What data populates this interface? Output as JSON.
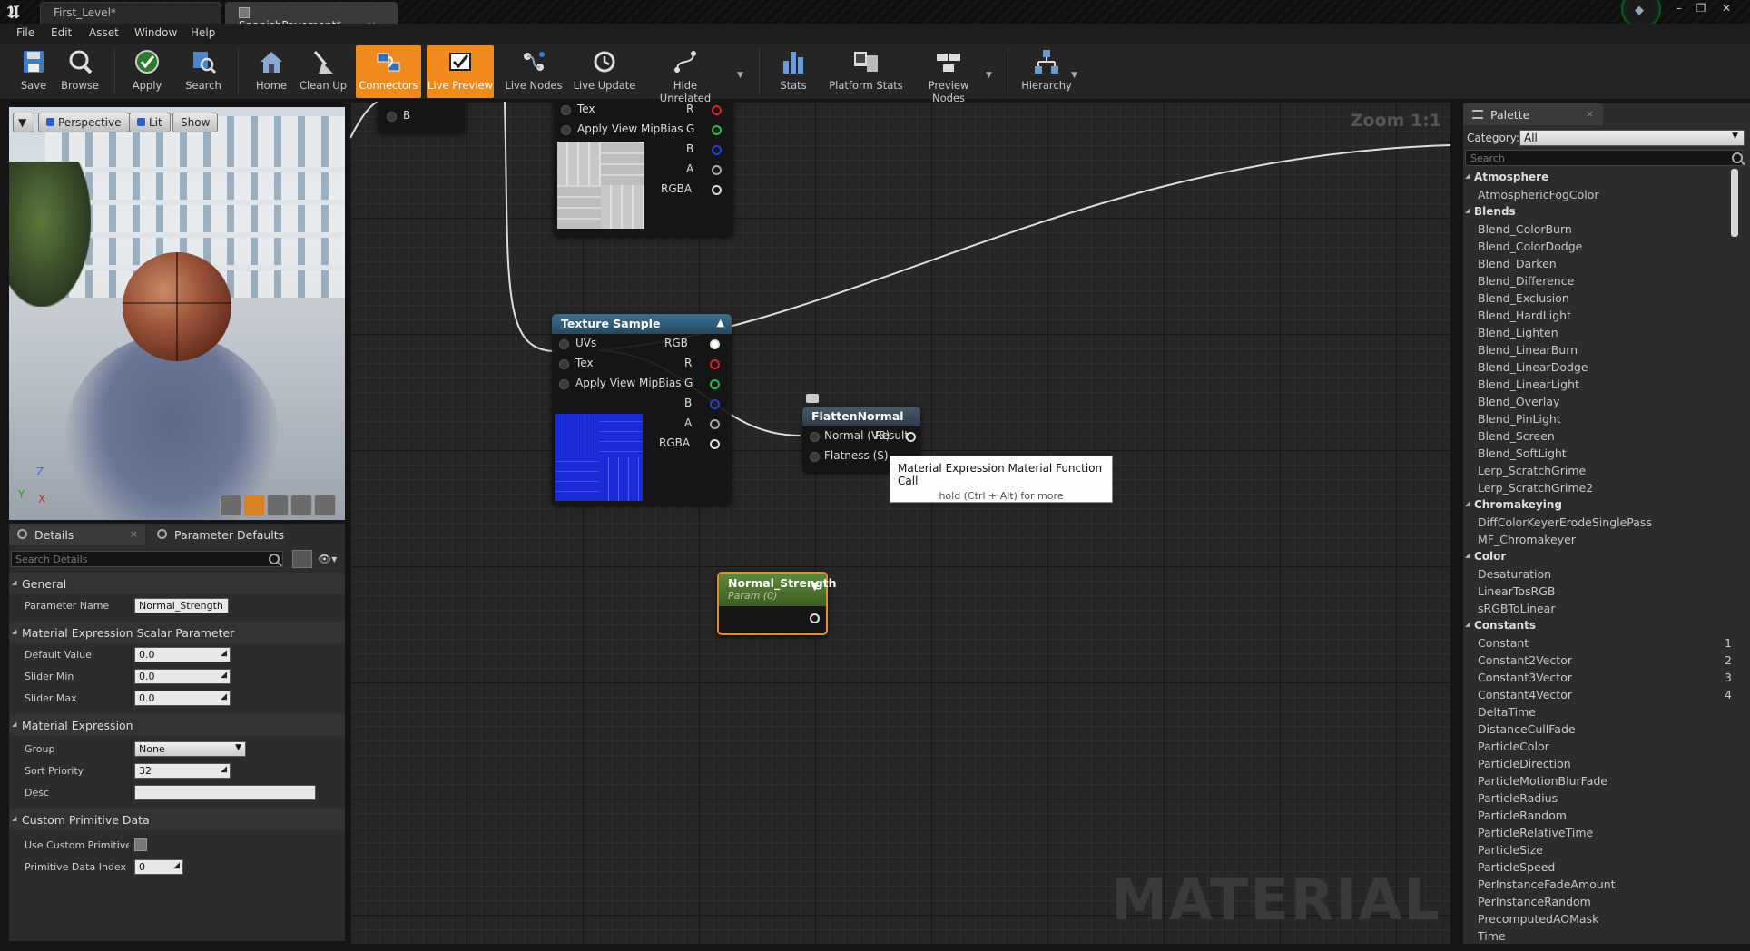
{
  "titlebar": {
    "tabs": [
      {
        "label": "First_Level*"
      },
      {
        "label": "SpanishPavement*",
        "close": "×"
      }
    ],
    "window_buttons": [
      "–",
      "❐",
      "✕"
    ]
  },
  "menu": [
    "File",
    "Edit",
    "Asset",
    "Window",
    "Help"
  ],
  "toolbar": {
    "buttons": [
      {
        "label": "Save",
        "icon": "save-icon"
      },
      {
        "label": "Browse",
        "icon": "browse-icon"
      },
      {
        "label": "Apply",
        "icon": "apply-icon"
      },
      {
        "label": "Search",
        "icon": "search-icon"
      },
      {
        "label": "Home",
        "icon": "home-icon"
      },
      {
        "label": "Clean Up",
        "icon": "clean-up-icon"
      },
      {
        "label": "Connectors",
        "icon": "connectors-icon",
        "active": true
      },
      {
        "label": "Live Preview",
        "icon": "live-preview-icon",
        "active": true
      },
      {
        "label": "Live Nodes",
        "icon": "live-nodes-icon"
      },
      {
        "label": "Live Update",
        "icon": "live-update-icon"
      },
      {
        "label": "Hide Unrelated",
        "icon": "hide-unrelated-icon"
      },
      {
        "label": "Stats",
        "icon": "stats-icon"
      },
      {
        "label": "Platform Stats",
        "icon": "platform-stats-icon"
      },
      {
        "label": "Preview Nodes",
        "icon": "preview-nodes-icon"
      },
      {
        "label": "Hierarchy",
        "icon": "hierarchy-icon"
      }
    ],
    "accent": "#f08a1d"
  },
  "viewport": {
    "perspective": "Perspective",
    "lit": "Lit",
    "show": "Show",
    "axis": {
      "z": "Z",
      "x": "X",
      "y": "Y"
    }
  },
  "details": {
    "tabs": [
      "Details",
      "Parameter Defaults"
    ],
    "search_placeholder": "Search Details",
    "sections": {
      "general": "General",
      "scalar": "Material Expression Scalar Parameter",
      "expression": "Material Expression",
      "custom": "Custom Primitive Data"
    },
    "props": {
      "parameter_name": {
        "label": "Parameter Name",
        "value": "Normal_Strength"
      },
      "default_value": {
        "label": "Default Value",
        "value": "0.0"
      },
      "slider_min": {
        "label": "Slider Min",
        "value": "0.0"
      },
      "slider_max": {
        "label": "Slider Max",
        "value": "0.0"
      },
      "group": {
        "label": "Group",
        "value": "None"
      },
      "sort_priority": {
        "label": "Sort Priority",
        "value": "32"
      },
      "desc": {
        "label": "Desc",
        "value": ""
      },
      "use_custom": {
        "label": "Use Custom Primitive Data",
        "checked": false
      },
      "prim_index": {
        "label": "Primitive Data Index",
        "value": "0"
      }
    }
  },
  "graph": {
    "zoom": "Zoom 1:1",
    "watermark": "MATERIAL",
    "partial_node": {
      "pin": "B"
    },
    "tex_top": {
      "pins_in": [
        "Tex",
        "Apply View MipBias"
      ],
      "pins_out": [
        "R",
        "G",
        "B",
        "A",
        "RGBA"
      ]
    },
    "tex_main": {
      "title": "Texture Sample",
      "pins_in": [
        "UVs",
        "Tex",
        "Apply View MipBias"
      ],
      "pins_out": [
        "RGB",
        "R",
        "G",
        "B",
        "A",
        "RGBA"
      ]
    },
    "flatten": {
      "title": "FlattenNormal",
      "in1": "Normal (V3)",
      "out1": "Result",
      "in2": "Flatness (S)"
    },
    "tooltip": {
      "title": "Material Expression Material Function Call",
      "sub": "hold (Ctrl + Alt) for more"
    },
    "param": {
      "title": "Normal_Strength",
      "sub": "Param (0)"
    }
  },
  "palette": {
    "tab": "Palette",
    "category_label": "Category:",
    "category_value": "All",
    "search_placeholder": "Search",
    "groups": [
      {
        "name": "Atmosphere",
        "items": [
          "AtmosphericFogColor"
        ]
      },
      {
        "name": "Blends",
        "items": [
          "Blend_ColorBurn",
          "Blend_ColorDodge",
          "Blend_Darken",
          "Blend_Difference",
          "Blend_Exclusion",
          "Blend_HardLight",
          "Blend_Lighten",
          "Blend_LinearBurn",
          "Blend_LinearDodge",
          "Blend_LinearLight",
          "Blend_Overlay",
          "Blend_PinLight",
          "Blend_Screen",
          "Blend_SoftLight",
          "Lerp_ScratchGrime",
          "Lerp_ScratchGrime2"
        ]
      },
      {
        "name": "Chromakeying",
        "items": [
          "DiffColorKeyerErodeSinglePass",
          "MF_Chromakeyer"
        ]
      },
      {
        "name": "Color",
        "items": [
          "Desaturation",
          "LinearTosRGB",
          "sRGBToLinear"
        ]
      },
      {
        "name": "Constants",
        "items": [
          "Constant",
          "Constant2Vector",
          "Constant3Vector",
          "Constant4Vector",
          "DeltaTime",
          "DistanceCullFade",
          "ParticleColor",
          "ParticleDirection",
          "ParticleMotionBlurFade",
          "ParticleRadius",
          "ParticleRandom",
          "ParticleRelativeTime",
          "ParticleSize",
          "ParticleSpeed",
          "PerInstanceFadeAmount",
          "PerInstanceRandom",
          "PrecomputedAOMask",
          "Time"
        ]
      }
    ],
    "hotkeys": {
      "Constant": "1",
      "Constant2Vector": "2",
      "Constant3Vector": "3",
      "Constant4Vector": "4"
    }
  }
}
